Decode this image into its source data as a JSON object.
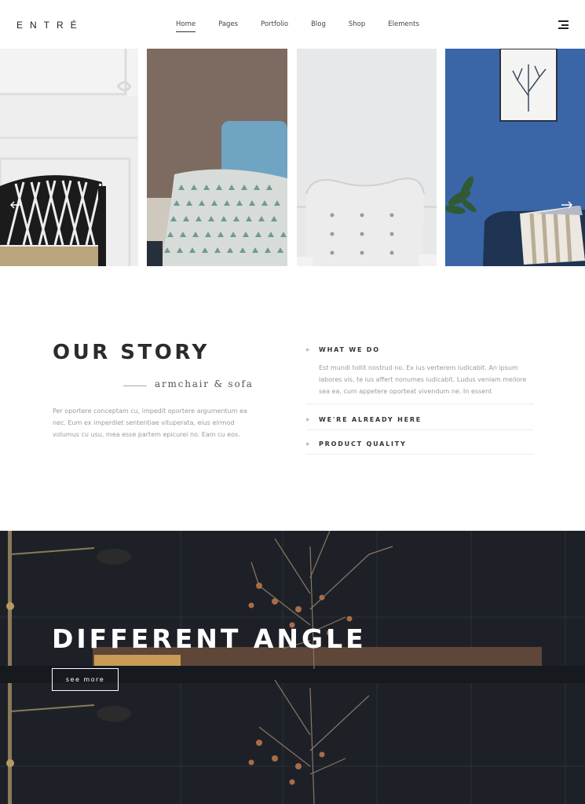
{
  "header": {
    "logo": "ENTRÉ",
    "nav": [
      "Home",
      "Pages",
      "Portfolio",
      "Blog",
      "Shop",
      "Elements"
    ],
    "active_index": 0
  },
  "slider": {
    "prev_icon": "arrow-left-icon",
    "next_icon": "arrow-right-icon"
  },
  "story": {
    "title": "OUR STORY",
    "subtitle": "armchair & sofa",
    "text": "Per oportere conceptam cu, impedit oportere argumentum ea nec. Eum ex imperdiet sententiae vituperata, eius eirmod volumus cu usu, mea esse partem epicurei no. Eam cu eos."
  },
  "accordion": [
    {
      "label": "WHAT WE DO",
      "body": "Est mundi tollit nostrud no. Ex ius verterem iudicabit. An ipsum labores vis, te ius affert nonumes iudicabit. Ludus veniam meliore sea ea, cum appetere oporteat vivendum ne. In essent"
    },
    {
      "label": "WE'RE ALREADY HERE"
    },
    {
      "label": "PRODUCT QUALITY"
    }
  ],
  "banner": {
    "title": "DIFFERENT ANGLE",
    "button": "see more"
  },
  "colors": {
    "dark_bg": "#1d2127",
    "blue_wall": "#3a66a8",
    "text_main": "#2b2b2b",
    "text_muted": "#9a9a9a"
  }
}
